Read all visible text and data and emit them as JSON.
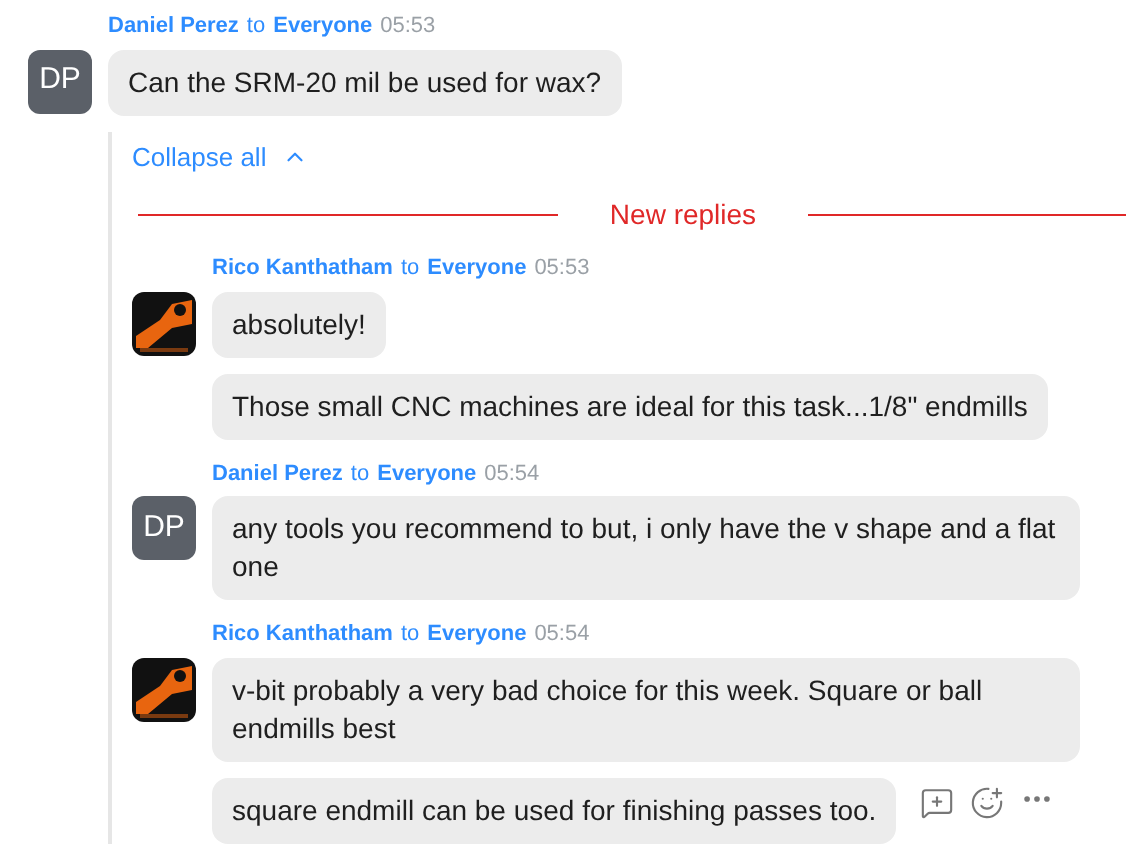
{
  "message": {
    "sender": "Daniel Perez",
    "to_word": "to",
    "recipient": "Everyone",
    "time": "05:53",
    "avatar": {
      "kind": "initials",
      "text": "DP"
    },
    "bubbles": [
      {
        "text": "Can the SRM-20 mil be used for wax?",
        "hovered": false
      }
    ]
  },
  "thread": {
    "collapse_label": "Collapse all",
    "divider_label": "New replies",
    "replies": [
      {
        "sender": "Rico Kanthatham",
        "to_word": "to",
        "recipient": "Everyone",
        "time": "05:53",
        "avatar": {
          "kind": "picture"
        },
        "bubbles": [
          {
            "text": "absolutely!",
            "hovered": false
          },
          {
            "text": "Those small CNC machines are ideal for this task...1/8\" endmills",
            "hovered": false
          }
        ]
      },
      {
        "sender": "Daniel Perez",
        "to_word": "to",
        "recipient": "Everyone",
        "time": "05:54",
        "avatar": {
          "kind": "initials",
          "text": "DP"
        },
        "bubbles": [
          {
            "text": "any tools you recommend to but, i only have the v shape and a flat one",
            "hovered": false
          }
        ]
      },
      {
        "sender": "Rico Kanthatham",
        "to_word": "to",
        "recipient": "Everyone",
        "time": "05:54",
        "avatar": {
          "kind": "picture"
        },
        "bubbles": [
          {
            "text": "v-bit probably a very bad choice for this week. Square or ball endmills best",
            "hovered": false
          },
          {
            "text": "square endmill can be used for finishing passes too.",
            "hovered": true
          }
        ]
      }
    ]
  }
}
